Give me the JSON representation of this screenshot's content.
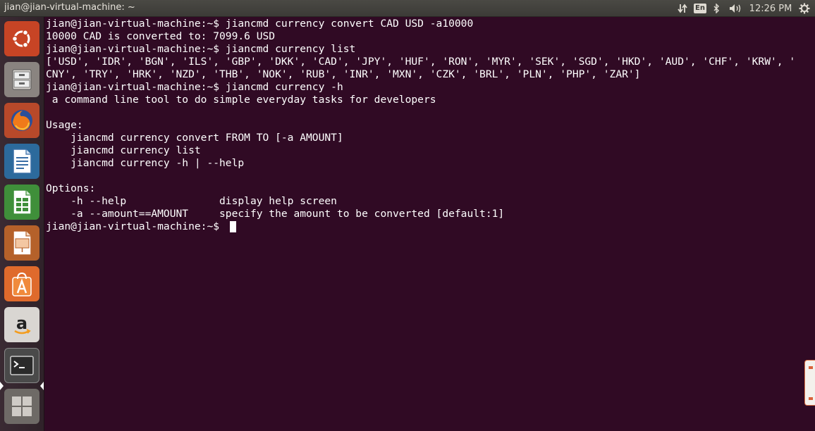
{
  "window": {
    "title": "jian@jian-virtual-machine: ~"
  },
  "panel": {
    "keyboard_layout": "En",
    "clock": "12:26 PM",
    "icons": [
      "network-arrows-icon",
      "keyboard-layout-icon",
      "bluetooth-icon",
      "volume-icon",
      "clock",
      "session-gear-icon"
    ]
  },
  "launcher": {
    "items": [
      {
        "name": "ubuntu-dash-icon"
      },
      {
        "name": "files-icon"
      },
      {
        "name": "firefox-icon"
      },
      {
        "name": "libreoffice-writer-icon"
      },
      {
        "name": "libreoffice-calc-icon"
      },
      {
        "name": "libreoffice-impress-icon"
      },
      {
        "name": "software-center-icon"
      },
      {
        "name": "amazon-icon"
      },
      {
        "name": "terminal-icon"
      },
      {
        "name": "workspace-switcher-icon"
      }
    ]
  },
  "terminal": {
    "lines": [
      "jian@jian-virtual-machine:~$ jiancmd currency convert CAD USD -a10000",
      "10000 CAD is converted to: 7099.6 USD",
      "jian@jian-virtual-machine:~$ jiancmd currency list",
      "['USD', 'IDR', 'BGN', 'ILS', 'GBP', 'DKK', 'CAD', 'JPY', 'HUF', 'RON', 'MYR', 'SEK', 'SGD', 'HKD', 'AUD', 'CHF', 'KRW', '",
      "CNY', 'TRY', 'HRK', 'NZD', 'THB', 'NOK', 'RUB', 'INR', 'MXN', 'CZK', 'BRL', 'PLN', 'PHP', 'ZAR']",
      "jian@jian-virtual-machine:~$ jiancmd currency -h",
      " a command line tool to do simple everyday tasks for developers",
      "",
      "Usage:",
      "    jiancmd currency convert FROM TO [-a AMOUNT]",
      "    jiancmd currency list",
      "    jiancmd currency -h | --help",
      "",
      "Options:",
      "    -h --help               display help screen",
      "    -a --amount==AMOUNT     specify the amount to be converted [default:1]",
      "jian@jian-virtual-machine:~$ "
    ]
  },
  "colors": {
    "terminal_bg": "#300a24",
    "terminal_fg": "#ffffff",
    "panel_bg": "#3c3b37",
    "launcher_bg": "#33252c"
  }
}
